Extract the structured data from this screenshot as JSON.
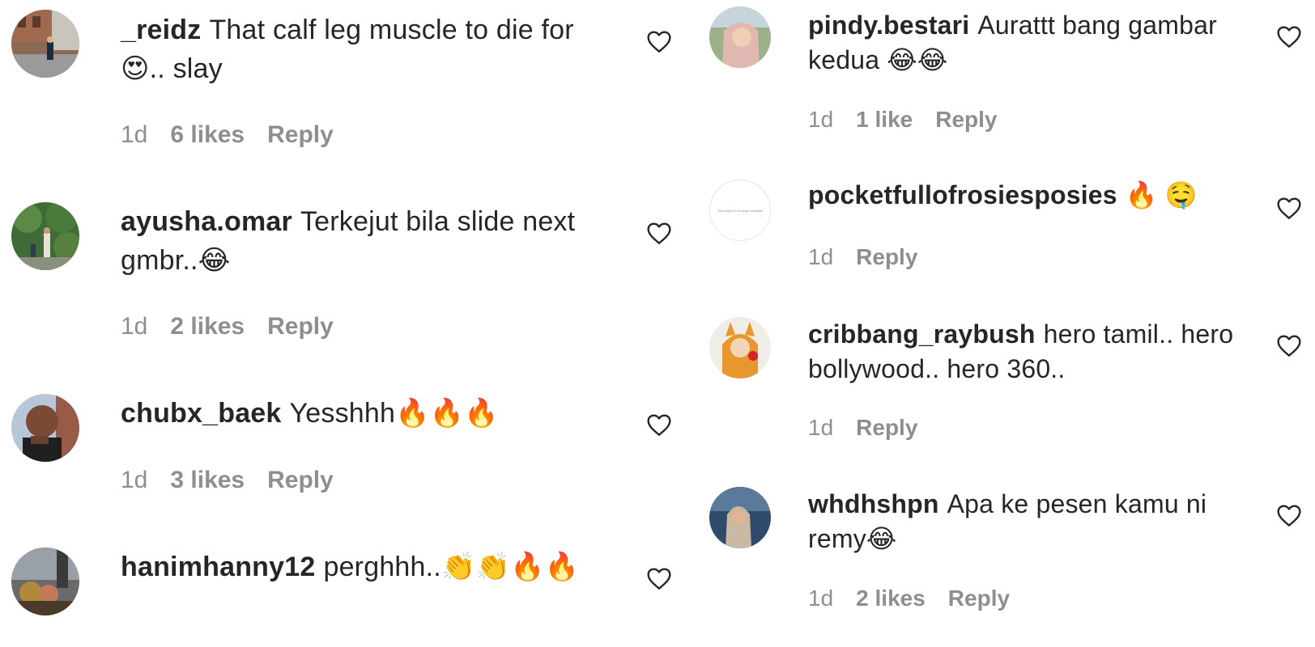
{
  "left_comments": [
    {
      "username": "_reidz",
      "text": "That calf leg muscle to die for 😍.. slay",
      "time": "1d",
      "likes": "6 likes",
      "reply": "Reply",
      "avatar_icon": "avatar-reidz"
    },
    {
      "username": "ayusha.omar",
      "text": "Terkejut bila slide next gmbr..😂",
      "time": "1d",
      "likes": "2 likes",
      "reply": "Reply",
      "avatar_icon": "avatar-ayusha"
    },
    {
      "username": "chubx_baek",
      "text": "Yesshhh🔥🔥🔥",
      "time": "1d",
      "likes": "3 likes",
      "reply": "Reply",
      "avatar_icon": "avatar-chubx"
    },
    {
      "username": "hanimhanny12",
      "text": "perghhh..👏👏🔥🔥",
      "time": "",
      "likes": "",
      "reply": "",
      "avatar_icon": "avatar-hanim"
    }
  ],
  "right_comments": [
    {
      "username": "pindy.bestari",
      "text": "Aurattt bang gambar kedua 😂😂",
      "time": "1d",
      "likes": "1 like",
      "reply": "Reply",
      "avatar_icon": "avatar-pindy"
    },
    {
      "username": "pocketfullofrosiesposies",
      "text": "🔥 🤤",
      "time": "1d",
      "likes": "",
      "reply": "Reply",
      "avatar_icon": "avatar-unavailable",
      "avatar_caption": "This image is no longer available"
    },
    {
      "username": "cribbang_raybush",
      "text": "hero tamil.. hero bollywood.. hero 360..",
      "time": "1d",
      "likes": "",
      "reply": "Reply",
      "avatar_icon": "avatar-cribbang"
    },
    {
      "username": "whdhshpn",
      "text": "Apa ke pesen kamu ni remy😂",
      "time": "1d",
      "likes": "2 likes",
      "reply": "Reply",
      "avatar_icon": "avatar-whdhshpn"
    }
  ],
  "icons": {
    "like": "heart-outline-icon"
  },
  "colors": {
    "text": "#262626",
    "muted": "#8e8e8e",
    "background": "#ffffff"
  }
}
